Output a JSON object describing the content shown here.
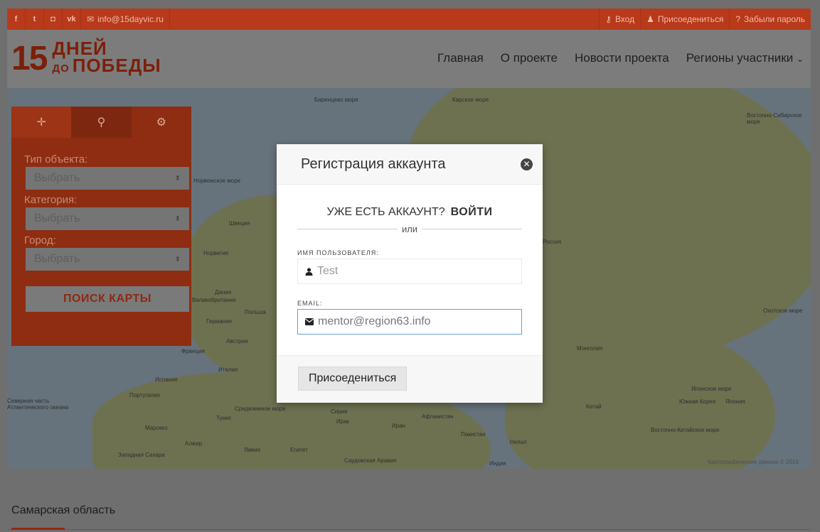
{
  "topbar": {
    "social": [
      {
        "icon": "facebook-icon",
        "glyph": "f"
      },
      {
        "icon": "twitter-icon",
        "glyph": "t"
      },
      {
        "icon": "instagram-icon",
        "glyph": "◘"
      },
      {
        "icon": "vk-icon",
        "glyph": "vk"
      }
    ],
    "email": "info@15dayvic.ru",
    "login": "Вход",
    "join": "Присоедениться",
    "forgot": "Забыли пароль"
  },
  "logo": {
    "number": "15",
    "line1": "ДНЕЙ",
    "line2_small": "ДО",
    "line2": "ПОБЕДЫ"
  },
  "nav": {
    "home": "Главная",
    "about": "О проекте",
    "news": "Новости проекта",
    "regions": "Регионы участники"
  },
  "map": {
    "labels": [
      "Баренцево море",
      "Карское море",
      "Восточно-Сибирское море",
      "Норвежское море",
      "Швеция",
      "Норвегия",
      "Дания",
      "Великобритания",
      "Польша",
      "Германия",
      "Франция",
      "Австрия",
      "Италия",
      "Испания",
      "Португалия",
      "Россия",
      "Монголия",
      "Китай",
      "Япония",
      "Южная Корея",
      "Японское море",
      "Охотское море",
      "Восточно-Китайское море",
      "Средиземное море",
      "Тунис",
      "Алжир",
      "Марокко",
      "Западная Сахара",
      "Ливия",
      "Египет",
      "Сирия",
      "Ирак",
      "Иран",
      "Афганистан",
      "Пакистан",
      "Непал",
      "Индия",
      "Саудовская Аравия",
      "Северная часть Атлантического океана"
    ],
    "attribution": "Картографические данные © 2016"
  },
  "filter": {
    "tabs": [
      {
        "icon": "move-icon",
        "glyph": "✛"
      },
      {
        "icon": "search-icon",
        "glyph": "⚲"
      },
      {
        "icon": "settings-icon",
        "glyph": "⚙"
      }
    ],
    "type_label": "Тип объекта:",
    "type_value": "Выбрать",
    "category_label": "Категория:",
    "category_value": "Выбрать",
    "city_label": "Город:",
    "city_value": "Выбрать",
    "search_button": "ПОИСК КАРТЫ"
  },
  "modal": {
    "title": "Регистрация аккаунта",
    "have_account": "УЖЕ ЕСТЬ АККАУНТ?",
    "login_link": "ВОЙТИ",
    "or": "или",
    "username_label": "ИМЯ ПОЛЬЗОВАТЕЛЯ:",
    "username_value": "Test",
    "email_label": "EMAIL:",
    "email_value": "mentor@region63.info",
    "submit": "Присоедениться"
  },
  "content": {
    "region_title": "Самарская область"
  },
  "colors": {
    "brand": "#b83a1b",
    "panel": "#8e2d12",
    "overlay": "#6f6f6f"
  }
}
